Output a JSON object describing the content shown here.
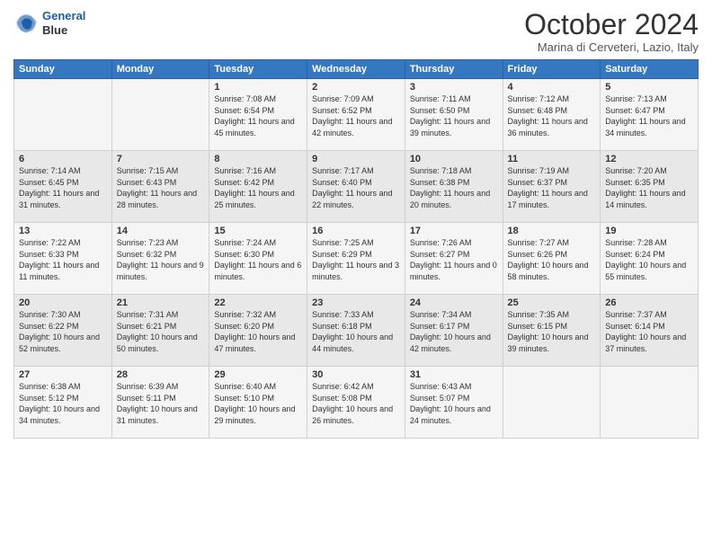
{
  "logo": {
    "line1": "General",
    "line2": "Blue"
  },
  "title": "October 2024",
  "subtitle": "Marina di Cerveteri, Lazio, Italy",
  "days_of_week": [
    "Sunday",
    "Monday",
    "Tuesday",
    "Wednesday",
    "Thursday",
    "Friday",
    "Saturday"
  ],
  "weeks": [
    [
      {
        "day": "",
        "info": ""
      },
      {
        "day": "",
        "info": ""
      },
      {
        "day": "1",
        "info": "Sunrise: 7:08 AM\nSunset: 6:54 PM\nDaylight: 11 hours and 45 minutes."
      },
      {
        "day": "2",
        "info": "Sunrise: 7:09 AM\nSunset: 6:52 PM\nDaylight: 11 hours and 42 minutes."
      },
      {
        "day": "3",
        "info": "Sunrise: 7:11 AM\nSunset: 6:50 PM\nDaylight: 11 hours and 39 minutes."
      },
      {
        "day": "4",
        "info": "Sunrise: 7:12 AM\nSunset: 6:48 PM\nDaylight: 11 hours and 36 minutes."
      },
      {
        "day": "5",
        "info": "Sunrise: 7:13 AM\nSunset: 6:47 PM\nDaylight: 11 hours and 34 minutes."
      }
    ],
    [
      {
        "day": "6",
        "info": "Sunrise: 7:14 AM\nSunset: 6:45 PM\nDaylight: 11 hours and 31 minutes."
      },
      {
        "day": "7",
        "info": "Sunrise: 7:15 AM\nSunset: 6:43 PM\nDaylight: 11 hours and 28 minutes."
      },
      {
        "day": "8",
        "info": "Sunrise: 7:16 AM\nSunset: 6:42 PM\nDaylight: 11 hours and 25 minutes."
      },
      {
        "day": "9",
        "info": "Sunrise: 7:17 AM\nSunset: 6:40 PM\nDaylight: 11 hours and 22 minutes."
      },
      {
        "day": "10",
        "info": "Sunrise: 7:18 AM\nSunset: 6:38 PM\nDaylight: 11 hours and 20 minutes."
      },
      {
        "day": "11",
        "info": "Sunrise: 7:19 AM\nSunset: 6:37 PM\nDaylight: 11 hours and 17 minutes."
      },
      {
        "day": "12",
        "info": "Sunrise: 7:20 AM\nSunset: 6:35 PM\nDaylight: 11 hours and 14 minutes."
      }
    ],
    [
      {
        "day": "13",
        "info": "Sunrise: 7:22 AM\nSunset: 6:33 PM\nDaylight: 11 hours and 11 minutes."
      },
      {
        "day": "14",
        "info": "Sunrise: 7:23 AM\nSunset: 6:32 PM\nDaylight: 11 hours and 9 minutes."
      },
      {
        "day": "15",
        "info": "Sunrise: 7:24 AM\nSunset: 6:30 PM\nDaylight: 11 hours and 6 minutes."
      },
      {
        "day": "16",
        "info": "Sunrise: 7:25 AM\nSunset: 6:29 PM\nDaylight: 11 hours and 3 minutes."
      },
      {
        "day": "17",
        "info": "Sunrise: 7:26 AM\nSunset: 6:27 PM\nDaylight: 11 hours and 0 minutes."
      },
      {
        "day": "18",
        "info": "Sunrise: 7:27 AM\nSunset: 6:26 PM\nDaylight: 10 hours and 58 minutes."
      },
      {
        "day": "19",
        "info": "Sunrise: 7:28 AM\nSunset: 6:24 PM\nDaylight: 10 hours and 55 minutes."
      }
    ],
    [
      {
        "day": "20",
        "info": "Sunrise: 7:30 AM\nSunset: 6:22 PM\nDaylight: 10 hours and 52 minutes."
      },
      {
        "day": "21",
        "info": "Sunrise: 7:31 AM\nSunset: 6:21 PM\nDaylight: 10 hours and 50 minutes."
      },
      {
        "day": "22",
        "info": "Sunrise: 7:32 AM\nSunset: 6:20 PM\nDaylight: 10 hours and 47 minutes."
      },
      {
        "day": "23",
        "info": "Sunrise: 7:33 AM\nSunset: 6:18 PM\nDaylight: 10 hours and 44 minutes."
      },
      {
        "day": "24",
        "info": "Sunrise: 7:34 AM\nSunset: 6:17 PM\nDaylight: 10 hours and 42 minutes."
      },
      {
        "day": "25",
        "info": "Sunrise: 7:35 AM\nSunset: 6:15 PM\nDaylight: 10 hours and 39 minutes."
      },
      {
        "day": "26",
        "info": "Sunrise: 7:37 AM\nSunset: 6:14 PM\nDaylight: 10 hours and 37 minutes."
      }
    ],
    [
      {
        "day": "27",
        "info": "Sunrise: 6:38 AM\nSunset: 5:12 PM\nDaylight: 10 hours and 34 minutes."
      },
      {
        "day": "28",
        "info": "Sunrise: 6:39 AM\nSunset: 5:11 PM\nDaylight: 10 hours and 31 minutes."
      },
      {
        "day": "29",
        "info": "Sunrise: 6:40 AM\nSunset: 5:10 PM\nDaylight: 10 hours and 29 minutes."
      },
      {
        "day": "30",
        "info": "Sunrise: 6:42 AM\nSunset: 5:08 PM\nDaylight: 10 hours and 26 minutes."
      },
      {
        "day": "31",
        "info": "Sunrise: 6:43 AM\nSunset: 5:07 PM\nDaylight: 10 hours and 24 minutes."
      },
      {
        "day": "",
        "info": ""
      },
      {
        "day": "",
        "info": ""
      }
    ]
  ]
}
